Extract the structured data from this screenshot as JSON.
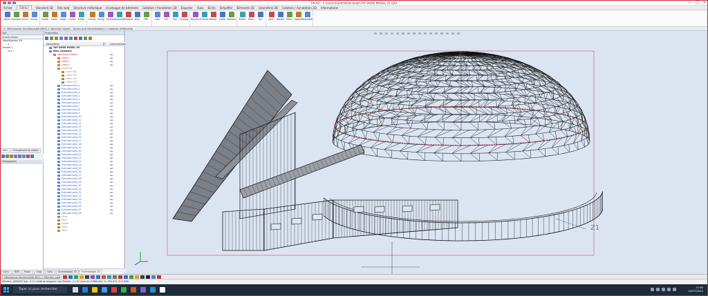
{
  "window": {
    "title": "FACAO - C:\\Users\\Gaeth\\Downloads\\TAP DOME MODEL 05.QZA",
    "controls": [
      "—",
      "□",
      "✕"
    ]
  },
  "menu": [
    "Fichier",
    "Edition",
    "Standard 3D",
    "Site web",
    "Structure métallique",
    "Enveloppe de bâtiment",
    "Cotation / Annotation 3D",
    "Exporter",
    "Vues",
    "Écrits",
    "Simplifier",
    "Éléments 2D",
    "Géométrie 2D",
    "Cotation / Annotation 2D",
    "Informations"
  ],
  "menu_active": "Édition",
  "ribbon": [
    {
      "buttons": [
        "Nouv.",
        "Nouveau",
        "Ouvrir",
        "Enreg."
      ]
    },
    {
      "buttons": [
        "Copier",
        "Coller",
        "Supp.",
        "Ouvrir",
        "Éditer"
      ]
    },
    {
      "buttons": [
        "Enreg.",
        "Enreg.",
        "Fermer",
        "Imprimer",
        "Élément",
        "Actu",
        "Réf."
      ]
    },
    {
      "buttons": [
        "Suiv.",
        "Cal.",
        "Pan.",
        "Échang."
      ]
    },
    {
      "buttons": [
        "Rayonn.",
        "Orienter",
        "Démar.",
        "Cadre",
        "Normes"
      ]
    },
    {
      "buttons": [
        "Éditer",
        "Élém.",
        "Inv."
      ]
    },
    {
      "buttons": [
        "Joint.",
        "Ajouter",
        "Élém.",
        "Options",
        "Propriété"
      ]
    }
  ],
  "docbar": "Sélectionner fonctionnalité (B03) > Sélection superf. - Toutes (Init intermédiaire) > Capturer d'éléments",
  "left_panel": {
    "header": "Vue",
    "subheader": "Numéro/Nom",
    "tree": [
      {
        "label": "Modélisation 3D",
        "red": false
      },
      {
        "label": "A",
        "red": true
      },
      {
        "label": "Feuille 1",
        "red": false
      },
      {
        "label": "Vue 1",
        "red": true
      }
    ],
    "tabs": [
      "Nom",
      "Changement de calque"
    ],
    "lower_header": "Désignation"
  },
  "mid_panel": {
    "header": "Ensembles",
    "columns": [
      "Désignation",
      "N°",
      "Commentaires"
    ],
    "items": [
      {
        "label": "TAP DOME MODEL 05",
        "indent": 1,
        "style": "blk"
      },
      {
        "label": "Main assembly",
        "indent": 1,
        "style": "blk"
      },
      {
        "label": "Spot Base Anglais",
        "indent": 2,
        "style": "red"
      },
      {
        "label": "Lintel 1",
        "indent": 3,
        "style": "red"
      },
      {
        "label": "Lintel 2",
        "indent": 3,
        "style": "red"
      },
      {
        "label": "Lintel 3",
        "indent": 3,
        "style": "red"
      },
      {
        "label": "Assembly",
        "indent": 3,
        "style": "gry"
      },
      {
        "label": "Lintel 30E",
        "indent": 4,
        "style": "gry"
      },
      {
        "label": "Lintel 31E",
        "indent": 4,
        "style": "gry"
      },
      {
        "label": "Lintel 32E",
        "indent": 4,
        "style": "gry"
      },
      {
        "label": "Lintel 33E",
        "indent": 4,
        "style": "gry"
      },
      {
        "label": "Extruded solid_1",
        "indent": 3,
        "style": "lbl"
      },
      {
        "label": "Extruded solid_2",
        "indent": 3,
        "style": "lbl"
      },
      {
        "label": "Extruded solid_3",
        "indent": 3,
        "style": "lbl"
      },
      {
        "label": "Extruded solid_4",
        "indent": 3,
        "style": "lbl"
      },
      {
        "label": "Extruded solid_5",
        "indent": 3,
        "style": "lbl"
      },
      {
        "label": "Extruded solid_6",
        "indent": 3,
        "style": "lbl"
      },
      {
        "label": "Extruded solid_7",
        "indent": 3,
        "style": "lbl"
      },
      {
        "label": "Extruded solid_8",
        "indent": 3,
        "style": "lbl"
      },
      {
        "label": "Extruded solid_9",
        "indent": 3,
        "style": "lbl"
      },
      {
        "label": "Extruded solid_10",
        "indent": 3,
        "style": "lbl"
      },
      {
        "label": "Extruded solid_11",
        "indent": 3,
        "style": "lbl"
      },
      {
        "label": "Extruded solid_12",
        "indent": 3,
        "style": "lbl"
      },
      {
        "label": "Extruded solid_13",
        "indent": 3,
        "style": "lbl"
      },
      {
        "label": "Extruded solid_14",
        "indent": 3,
        "style": "lbl"
      },
      {
        "label": "Extruded solid_15",
        "indent": 3,
        "style": "lbl"
      },
      {
        "label": "Extruded solid_16",
        "indent": 3,
        "style": "lbl"
      },
      {
        "label": "Extruded solid_17",
        "indent": 3,
        "style": "lbl"
      },
      {
        "label": "Extruded solid_18",
        "indent": 3,
        "style": "lbl"
      },
      {
        "label": "Extruded solid_19",
        "indent": 3,
        "style": "lbl"
      },
      {
        "label": "Extruded solid_20",
        "indent": 3,
        "style": "lbl"
      },
      {
        "label": "Extruded solid_21",
        "indent": 3,
        "style": "lbl"
      },
      {
        "label": "Extruded solid_22",
        "indent": 3,
        "style": "lbl"
      },
      {
        "label": "Extruded solid_23",
        "indent": 3,
        "style": "lbl"
      },
      {
        "label": "Extruded solid_24",
        "indent": 3,
        "style": "lbl"
      },
      {
        "label": "Extruded solid_25",
        "indent": 3,
        "style": "lbl"
      },
      {
        "label": "Extruded solid_26",
        "indent": 3,
        "style": "lbl"
      },
      {
        "label": "Extruded solid_27",
        "indent": 3,
        "style": "lbl"
      },
      {
        "label": "Extruded solid_28",
        "indent": 3,
        "style": "lbl"
      },
      {
        "label": "Extruded solid_29",
        "indent": 3,
        "style": "lbl"
      },
      {
        "label": "Extruded solid_30",
        "indent": 3,
        "style": "lbl"
      },
      {
        "label": "Extruded solid_31",
        "indent": 3,
        "style": "lbl"
      },
      {
        "label": "Extruded solid_32",
        "indent": 3,
        "style": "lbl"
      },
      {
        "label": "Extruded solid_33",
        "indent": 3,
        "style": "lbl"
      },
      {
        "label": "Extruded solid_34",
        "indent": 3,
        "style": "lbl"
      },
      {
        "label": "Extruded solid_35",
        "indent": 3,
        "style": "lbl"
      },
      {
        "label": "Extruded solid_36",
        "indent": 3,
        "style": "lbl"
      },
      {
        "label": "Extruded solid_37",
        "indent": 3,
        "style": "lbl"
      },
      {
        "label": "Extruded solid_38",
        "indent": 3,
        "style": "lbl"
      },
      {
        "label": "Pièce",
        "indent": 3,
        "style": "gry"
      },
      {
        "label": "Pièce",
        "indent": 3,
        "style": "gry"
      },
      {
        "label": "Profilé",
        "indent": 3,
        "style": "gry"
      },
      {
        "label": "Pièce",
        "indent": 3,
        "style": "gry"
      },
      {
        "label": "Pièce",
        "indent": 3,
        "style": "gry"
      }
    ],
    "selection_info": "Éléments sélectionnés : 0"
  },
  "bottom_tabs": [
    "Carto.",
    "BOM",
    "Propri.",
    "Grap.",
    "Varia.",
    "Ensemblages 3D",
    "Ensemblages 2D"
  ],
  "cmdbar": {
    "selection": "Sélectionner fonctionnalité (B03) > Sélection superf. - Toutes (Init intermédiaire) > C...",
    "icon_colors": [
      "#d03030",
      "#3070d0",
      "#30a050",
      "#e0a020",
      "#404040",
      "#8050c0",
      "#3070d0",
      "#c06030",
      "#30a0a0",
      "#707070",
      "#d03030",
      "#3070d0",
      "#30a050",
      "#e0a020",
      "#404040",
      "#202020",
      "#5080c0",
      "#c03040"
    ]
  },
  "status": "Élément _ASS0001 Vue : A  1:1  Unité de longueur: mm  Échelle : 1:1  SC local (X=27660.424, Y=-350.074, Z=0.000)",
  "viewport": {
    "axis_label": "Z1",
    "colors": {
      "background": "#dbe5f2",
      "wire": "#111111",
      "frame": "#d06070",
      "accent_red": "#c02030"
    }
  },
  "taskbar": {
    "search": "Taper ici pour rechercher",
    "time": "11:00",
    "date": "10/07/2024",
    "app_colors": [
      "#d8d8d8",
      "#2f7fd8",
      "#f0c020",
      "#3ca0e0",
      "#e04040",
      "#30b050",
      "#d85020",
      "#8060d0",
      "#2090d0",
      "#ffffff"
    ]
  }
}
